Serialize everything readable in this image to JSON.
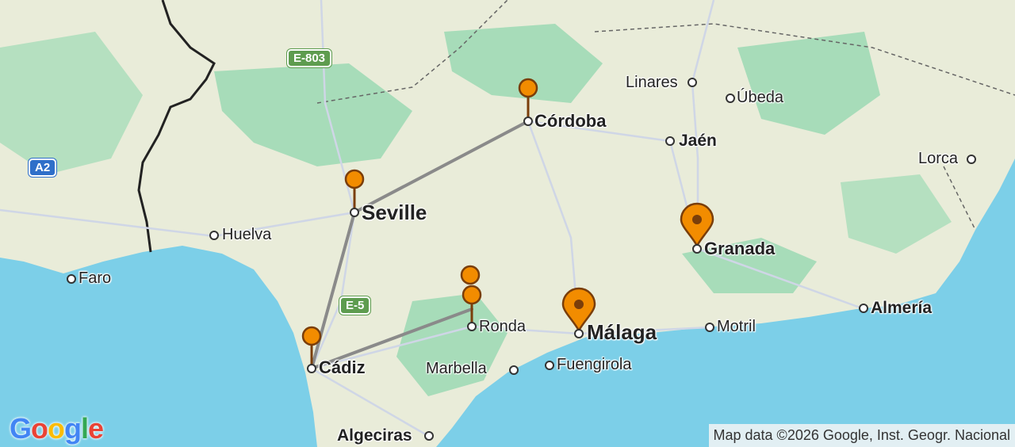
{
  "map": {
    "cities": [
      {
        "name": "Córdoba"
      },
      {
        "name": "Seville"
      },
      {
        "name": "Cádiz"
      },
      {
        "name": "Málaga"
      },
      {
        "name": "Granada"
      },
      {
        "name": "Ronda"
      },
      {
        "name": "Marbella"
      },
      {
        "name": "Fuengirola"
      },
      {
        "name": "Huelva"
      },
      {
        "name": "Faro"
      },
      {
        "name": "Linares"
      },
      {
        "name": "Úbeda"
      },
      {
        "name": "Jaén"
      },
      {
        "name": "Lorca"
      },
      {
        "name": "Motril"
      },
      {
        "name": "Almería"
      },
      {
        "name": "Algeciras"
      }
    ],
    "road_shields": {
      "e803": "E-803",
      "a2": "A2",
      "e5": "E-5"
    },
    "route_stops": [
      "Córdoba",
      "Seville",
      "Cádiz",
      "Ronda",
      "Málaga",
      "Granada"
    ],
    "colors": {
      "sea": "#7ccfe8",
      "land": "#e9ecd9",
      "forest": "#9fd9b5",
      "marker": "#f28c00",
      "route": "#8a8a8a"
    },
    "google_logo": {
      "letters": [
        "G",
        "o",
        "o",
        "g",
        "l",
        "e"
      ],
      "colors": [
        "#4285F4",
        "#EA4335",
        "#FBBC05",
        "#4285F4",
        "#34A853",
        "#EA4335"
      ]
    },
    "attribution": "Map data ©2026 Google, Inst. Geogr. Nacional"
  }
}
